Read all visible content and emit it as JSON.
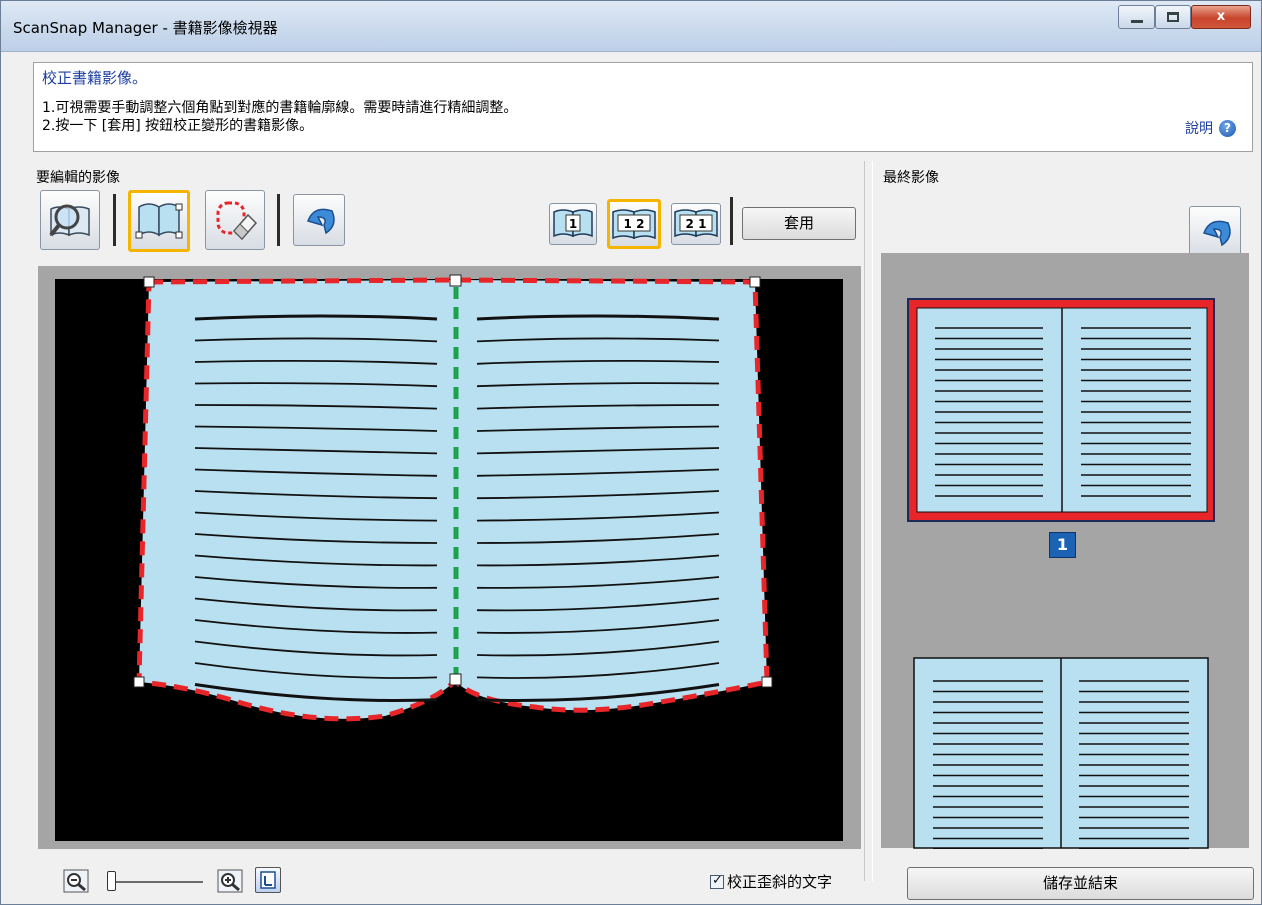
{
  "window": {
    "title": "ScanSnap Manager - 書籍影像檢視器",
    "close_glyph": "x"
  },
  "instructions": {
    "heading": "校正書籍影像。",
    "line1": "1.可視需要手動調整六個角點到對應的書籍輪廓線。需要時請進行精細調整。",
    "line2": "2.按一下 [套用] 按鈕校正變形的書籍影像。",
    "help_label": "說明",
    "help_glyph": "?"
  },
  "editor": {
    "label": "要編輯的影像",
    "page_buttons": [
      "1",
      "1 2",
      "2 1"
    ],
    "apply_label": "套用",
    "colors": {
      "page_fill": "#b9e0f0",
      "outline": "#e8262a",
      "center_line": "#1aa34a",
      "background": "#000000"
    }
  },
  "preview": {
    "label": "最終影像",
    "page_number": "1",
    "colors": {
      "selected_border": "#e8262a",
      "page_fill": "#b9e0f0"
    }
  },
  "bottom": {
    "checkbox_label": "校正歪斜的文字",
    "checkbox_checked": true,
    "checkbox_glyph": "✓",
    "save_label": "儲存並結束"
  }
}
